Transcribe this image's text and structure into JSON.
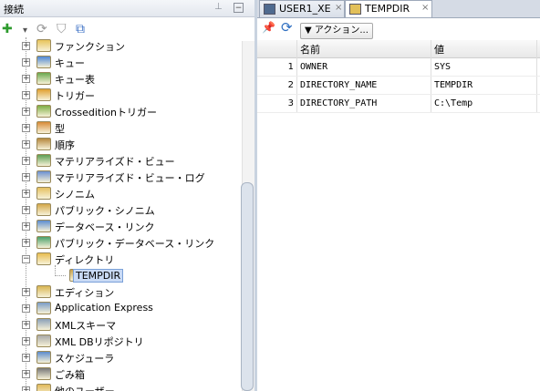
{
  "left_panel": {
    "title": "接続",
    "pin_glyph": "⊥",
    "minimize_glyph": "−",
    "toolbar": [
      {
        "name": "add-icon",
        "glyph": "✚",
        "color": "#2e9b2e"
      },
      {
        "name": "dropdown-arrow-icon",
        "glyph": "▾",
        "color": "#555555"
      },
      {
        "name": "refresh-icon",
        "glyph": "⟳",
        "color": "#9a9a9a"
      },
      {
        "name": "filter-icon",
        "glyph": "⛉",
        "color": "#9a9a9a"
      },
      {
        "name": "schema-browser-icon",
        "glyph": "⧉",
        "color": "#3a6fc4"
      }
    ],
    "tree": [
      {
        "label": "ファンクション",
        "icon": "function-icon",
        "level": 0
      },
      {
        "label": "キュー",
        "icon": "queue-icon",
        "level": 0
      },
      {
        "label": "キュー表",
        "icon": "queue-table-icon",
        "level": 0
      },
      {
        "label": "トリガー",
        "icon": "trigger-icon",
        "level": 0
      },
      {
        "label": "Crosseditionトリガー",
        "icon": "crossedition-trigger-icon",
        "level": 0
      },
      {
        "label": "型",
        "icon": "type-icon",
        "level": 0
      },
      {
        "label": "順序",
        "icon": "sequence-icon",
        "level": 0
      },
      {
        "label": "マテリアライズド・ビュー",
        "icon": "materialized-view-icon",
        "level": 0
      },
      {
        "label": "マテリアライズド・ビュー・ログ",
        "icon": "materialized-view-log-icon",
        "level": 0
      },
      {
        "label": "シノニム",
        "icon": "synonym-icon",
        "level": 0
      },
      {
        "label": "パブリック・シノニム",
        "icon": "public-synonym-icon",
        "level": 0
      },
      {
        "label": "データベース・リンク",
        "icon": "database-link-icon",
        "level": 0
      },
      {
        "label": "パブリック・データベース・リンク",
        "icon": "public-database-link-icon",
        "level": 0
      },
      {
        "label": "ディレクトリ",
        "icon": "directory-folder-icon",
        "level": 0,
        "expanded": true
      },
      {
        "label": "TEMPDIR",
        "icon": "directory-icon",
        "level": 1,
        "selected": true
      },
      {
        "label": "エディション",
        "icon": "edition-icon",
        "level": 0
      },
      {
        "label": "Application Express",
        "icon": "application-express-icon",
        "level": 0
      },
      {
        "label": "XMLスキーマ",
        "icon": "xml-schema-icon",
        "level": 0
      },
      {
        "label": "XML DBリポジトリ",
        "icon": "xml-db-repository-icon",
        "level": 0
      },
      {
        "label": "スケジューラ",
        "icon": "scheduler-icon",
        "level": 0
      },
      {
        "label": "ごみ箱",
        "icon": "recycle-bin-icon",
        "level": 0
      },
      {
        "label": "他のユーザー",
        "icon": "other-users-icon",
        "level": 0
      }
    ]
  },
  "right_panel": {
    "tabs": [
      {
        "label": "USER1_XE",
        "icon": "sql-worksheet-icon",
        "active": false,
        "close": "×"
      },
      {
        "label": "TEMPDIR",
        "icon": "directory-tab-icon",
        "active": true,
        "close": "×"
      }
    ],
    "toolbar": {
      "pin_icon_glyph": "📌",
      "refresh_icon_glyph": "⟳",
      "actions_label": "▼ アクション..."
    },
    "grid": {
      "headers": [
        "名前",
        "値"
      ],
      "rows": [
        {
          "num": "1",
          "name": "OWNER",
          "value": "SYS"
        },
        {
          "num": "2",
          "name": "DIRECTORY_NAME",
          "value": "TEMPDIR"
        },
        {
          "num": "3",
          "name": "DIRECTORY_PATH",
          "value": "C:\\Temp"
        }
      ]
    }
  }
}
